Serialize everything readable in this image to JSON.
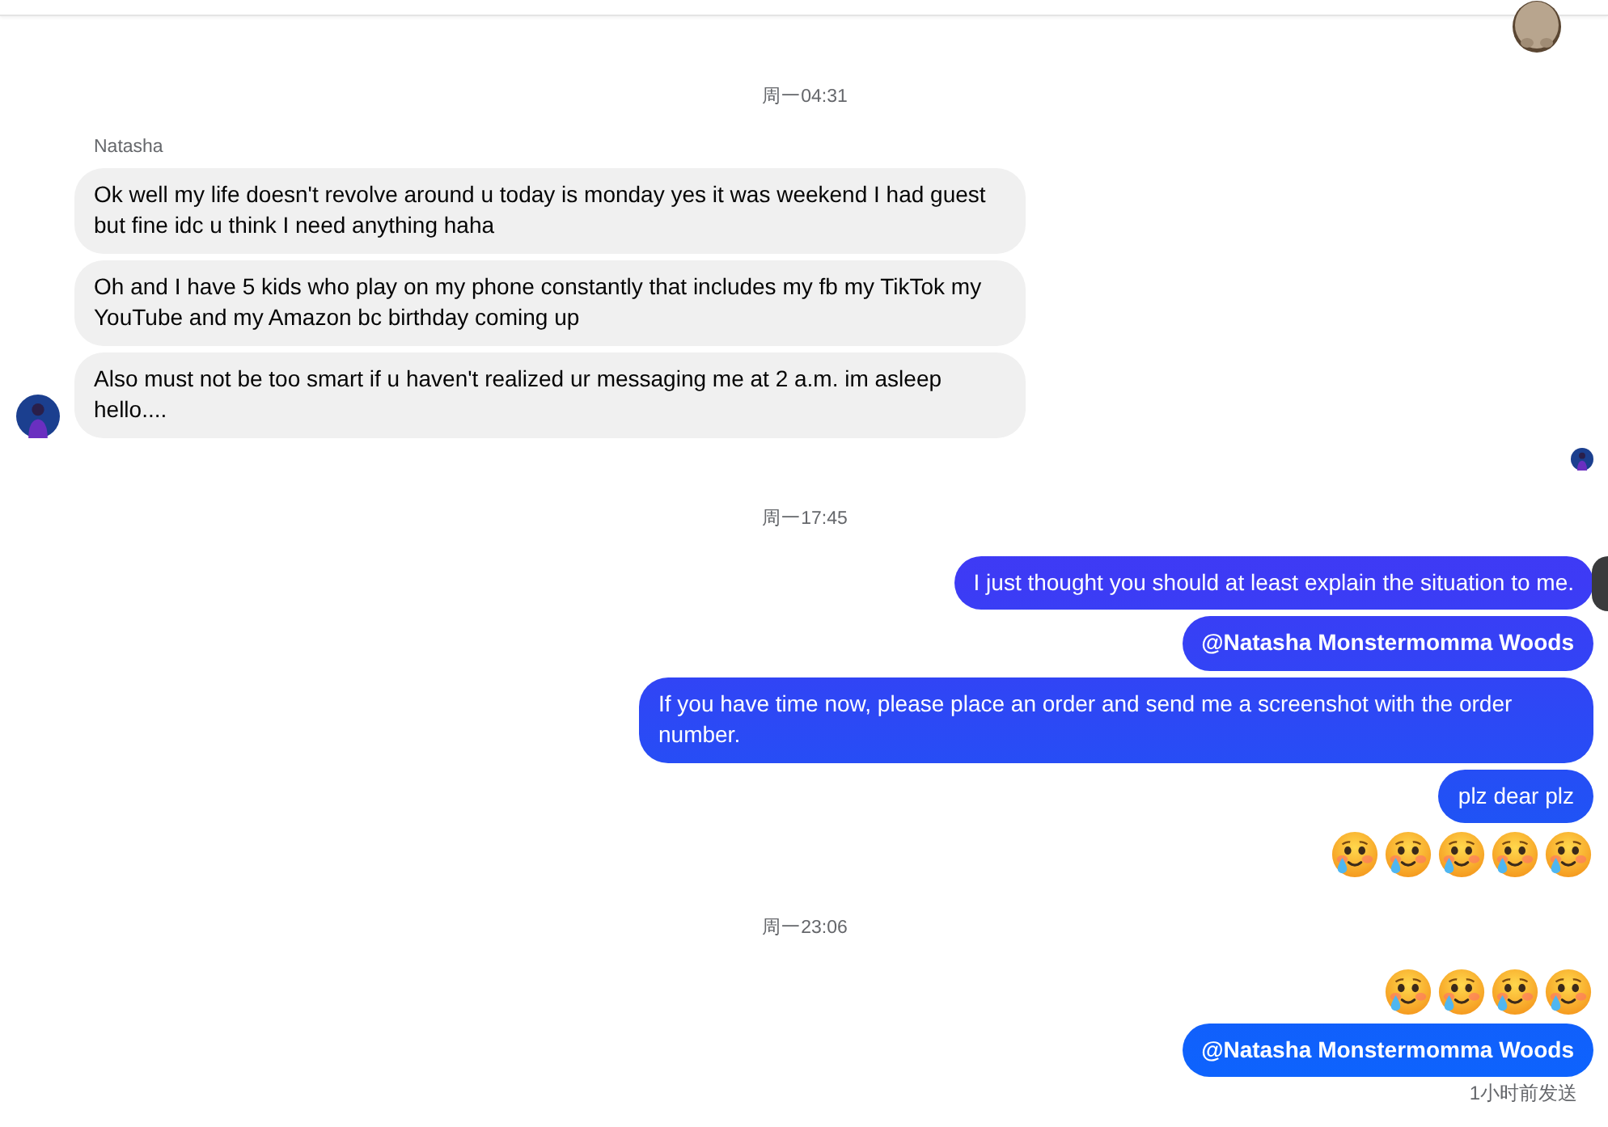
{
  "thread": [
    {
      "kind": "timestamp",
      "text": "周一04:31"
    },
    {
      "kind": "incoming",
      "sender": "Natasha",
      "messages": [
        {
          "text": "Ok well my life doesn't revolve around u today is monday yes it was weekend I had guest but fine idc u think I need anything haha"
        },
        {
          "text": "Oh and I have 5 kids who play on my phone constantly that includes my fb my TikTok my YouTube and my Amazon bc birthday coming up"
        },
        {
          "text": "Also must not be too smart if u haven't realized ur messaging me at 2 a.m. im asleep hello...."
        }
      ]
    },
    {
      "kind": "seen"
    },
    {
      "kind": "timestamp",
      "text": "周一17:45"
    },
    {
      "kind": "outgoing",
      "text": "I just thought you should at least explain the situation to me."
    },
    {
      "kind": "mention",
      "text": "@Natasha Monstermomma Woods"
    },
    {
      "kind": "outgoing",
      "text": "If you have time now, please place an order and send me a screenshot with the order number."
    },
    {
      "kind": "outgoing",
      "text": "plz dear plz"
    },
    {
      "kind": "emoji_row",
      "emojis": [
        {
          "kind": "emoji"
        },
        {
          "kind": "emoji"
        },
        {
          "kind": "emoji"
        },
        {
          "kind": "emoji"
        },
        {
          "kind": "emoji"
        }
      ]
    },
    {
      "kind": "timestamp",
      "text": "周一23:06"
    },
    {
      "kind": "emoji_row",
      "emojis": [
        {
          "kind": "emoji"
        },
        {
          "kind": "emoji"
        },
        {
          "kind": "emoji"
        },
        {
          "kind": "emoji"
        }
      ]
    },
    {
      "kind": "mention",
      "text": "@Natasha Monstermomma Woods"
    },
    {
      "kind": "status",
      "text": "1小时前发送"
    }
  ]
}
